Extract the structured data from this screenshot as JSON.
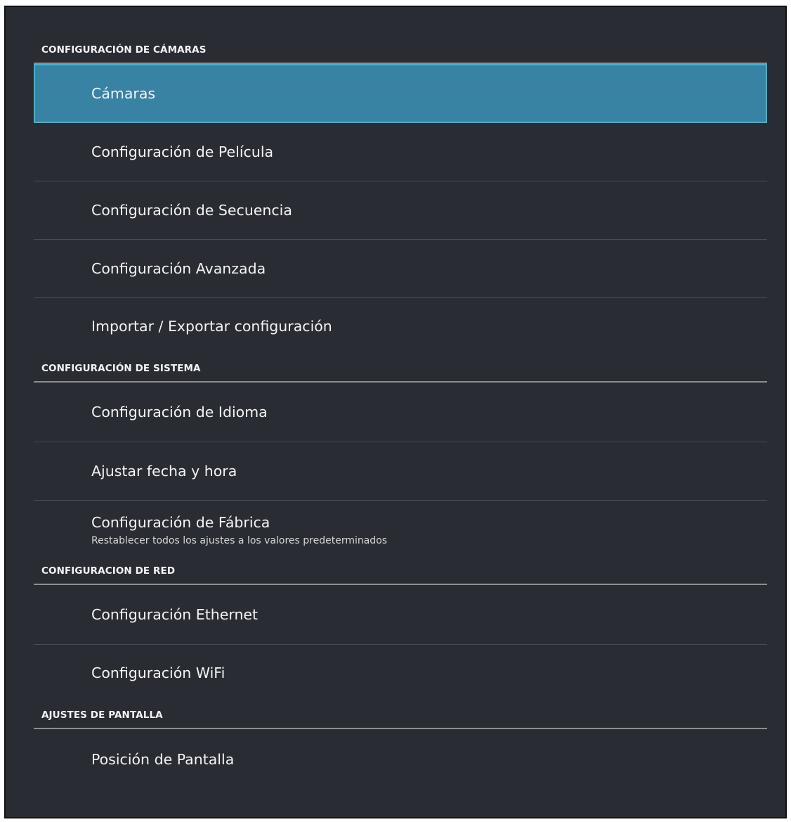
{
  "colors": {
    "background": "#2a2c33",
    "selected_fill": "#3883a4",
    "selected_border": "#33b9d8",
    "divider": "#4a4c52",
    "section_rule": "#8c8e92"
  },
  "sections": [
    {
      "title": "CONFIGURACIÓN DE CÁMARAS",
      "items": [
        {
          "label": "Cámaras",
          "selected": true
        },
        {
          "label": "Configuración de Película"
        },
        {
          "label": "Configuración de Secuencia"
        },
        {
          "label": "Configuración Avanzada"
        },
        {
          "label": "Importar / Exportar configuración"
        }
      ]
    },
    {
      "title": "CONFIGURACIÓN DE SISTEMA",
      "items": [
        {
          "label": "Configuración de Idioma"
        },
        {
          "label": "Ajustar fecha y hora"
        },
        {
          "label": "Configuración de Fábrica",
          "subtitle": "Restablecer todos los ajustes a los valores predeterminados"
        }
      ]
    },
    {
      "title": "CONFIGURACION DE RED",
      "items": [
        {
          "label": "Configuración Ethernet"
        },
        {
          "label": "Configuración WiFi"
        }
      ]
    },
    {
      "title": "AJUSTES DE PANTALLA",
      "items": [
        {
          "label": "Posición de Pantalla"
        }
      ]
    }
  ]
}
